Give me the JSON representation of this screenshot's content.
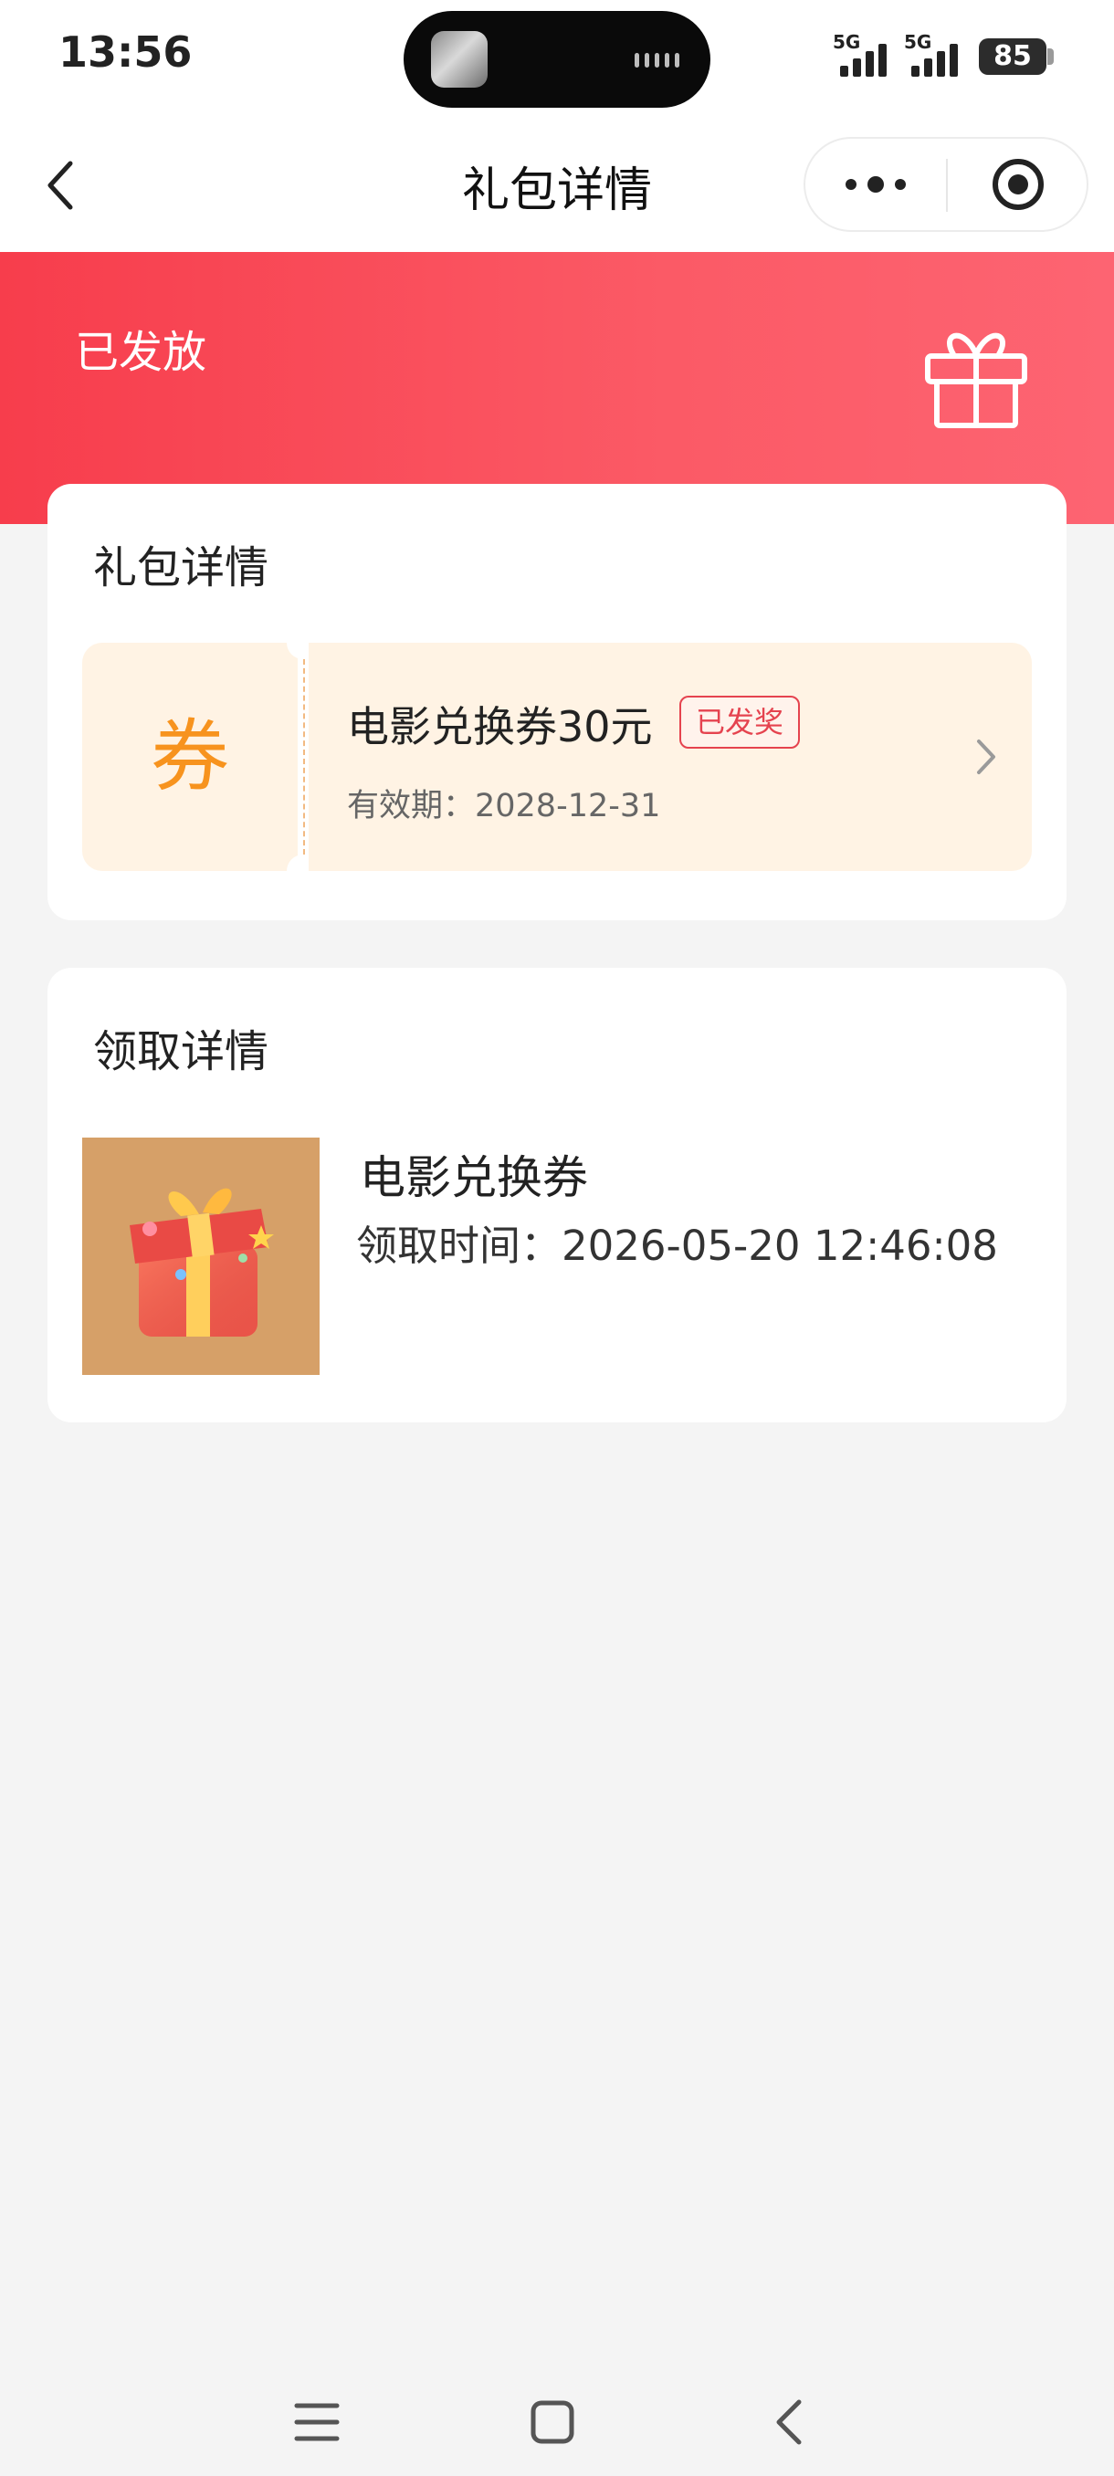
{
  "status_bar": {
    "time": "13:56",
    "sim1": "5G",
    "sim2": "5G",
    "battery": "85"
  },
  "nav": {
    "title": "礼包详情"
  },
  "banner": {
    "status": "已发放"
  },
  "gift_card": {
    "title": "礼包详情",
    "coupon": {
      "badge": "券",
      "name": "电影兑换券30元",
      "tag": "已发奖",
      "expiry": "有效期：2028-12-31"
    }
  },
  "receive_card": {
    "title": "领取详情",
    "item_name": "电影兑换券",
    "received_at": "领取时间：2026-05-20 12:46:08"
  },
  "colors": {
    "brand_red": "#f73d4c",
    "coupon_orange": "#f7931e",
    "coupon_bg": "#fff3e4",
    "tag_red": "#e5434f"
  }
}
